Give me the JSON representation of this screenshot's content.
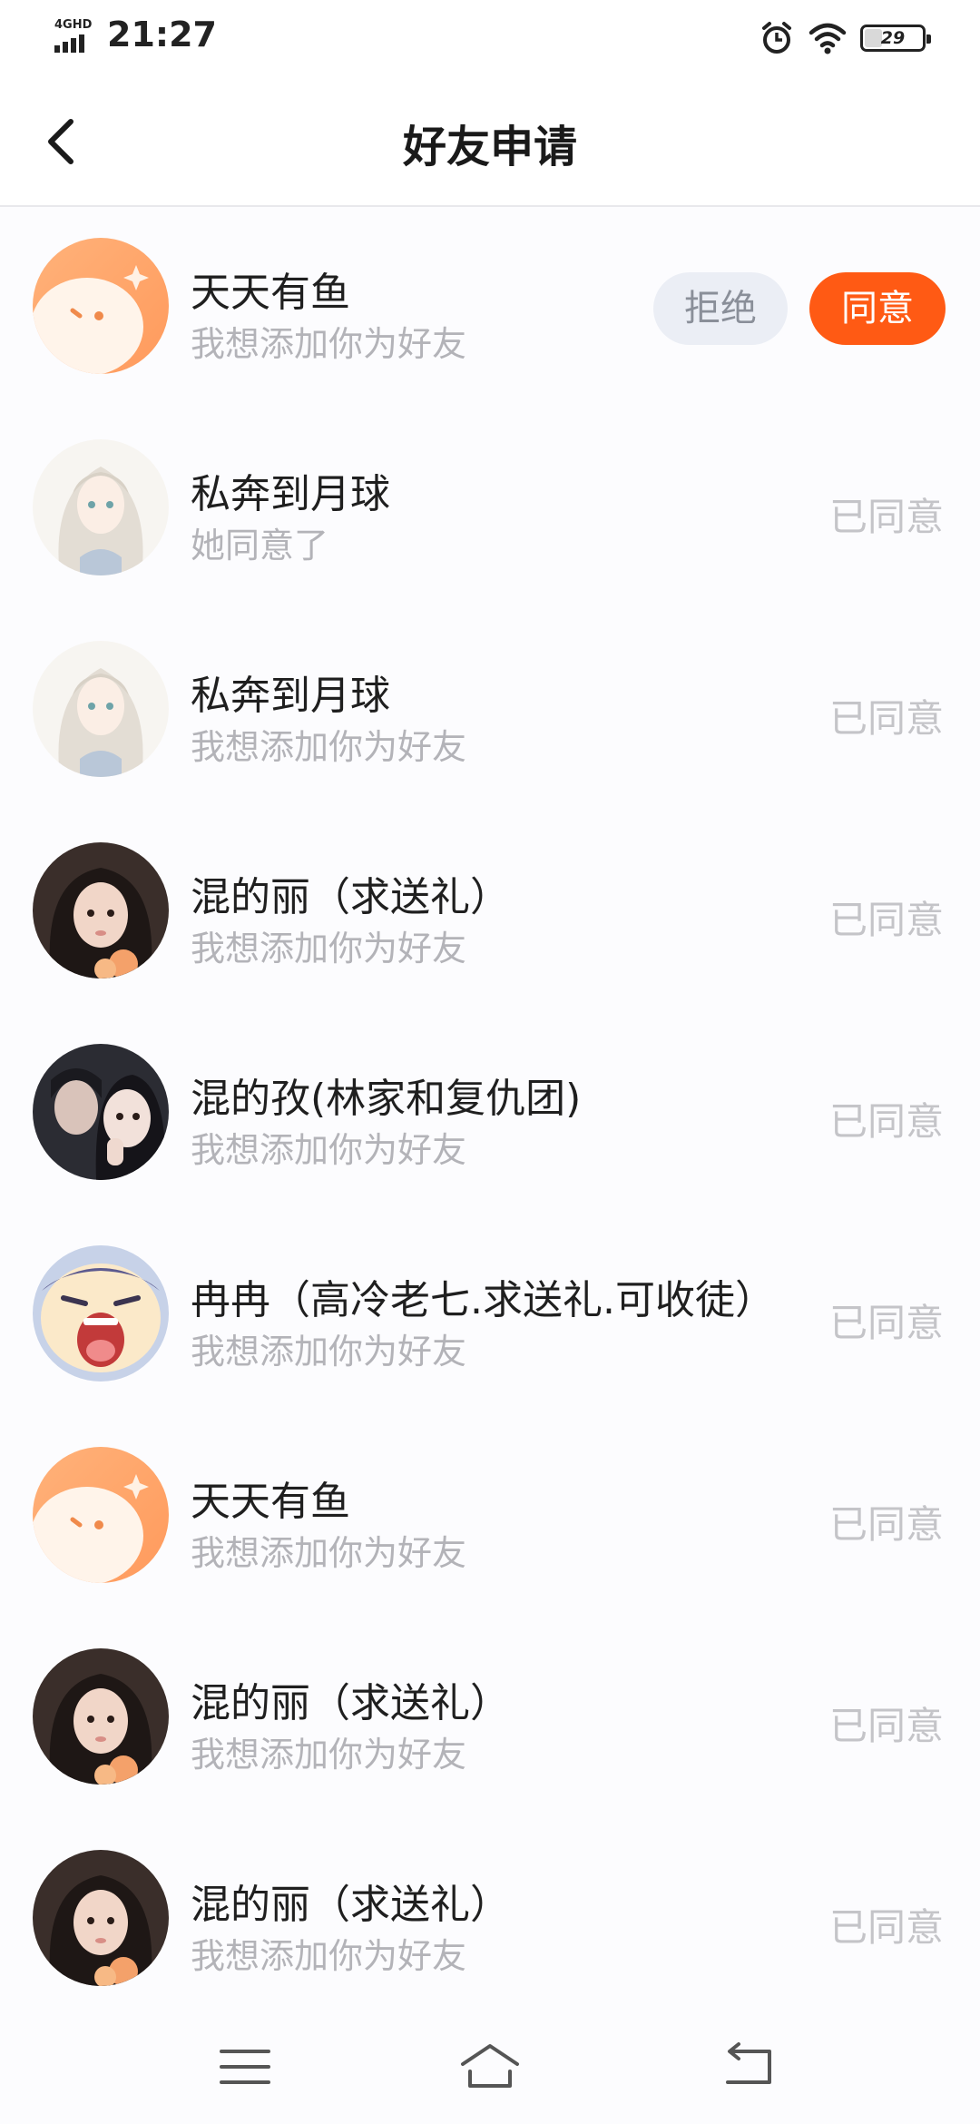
{
  "status_bar": {
    "network": "4GHD",
    "time": "21:27",
    "battery": "29",
    "battery_level": 0.29,
    "icons": [
      "signal-icon",
      "alarm-icon",
      "wifi-icon",
      "battery-icon"
    ]
  },
  "header": {
    "title": "好友申请",
    "back_icon": "chevron-left-icon"
  },
  "colors": {
    "accent": "#ff5a14",
    "reject_bg": "#ebeef5",
    "muted_text": "#b3b3b8"
  },
  "requests": [
    {
      "name": "天天有鱼",
      "message": "我想添加你为好友",
      "reject_label": "拒绝",
      "accept_label": "同意",
      "avatar": "fish-avatar"
    },
    {
      "name": "私奔到月球",
      "message": "她同意了",
      "status": "已同意",
      "avatar": "anime-girl-avatar"
    },
    {
      "name": "私奔到月球",
      "message": "我想添加你为好友",
      "status": "已同意",
      "avatar": "anime-girl-avatar"
    },
    {
      "name": "混的丽（求送礼）",
      "message": "我想添加你为好友",
      "status": "已同意",
      "avatar": "photo-avatar"
    },
    {
      "name": "混的孜(林家和复仇团)",
      "message": "我想添加你为好友",
      "status": "已同意",
      "avatar": "photo-avatar"
    },
    {
      "name": "冉冉（高冷老七.求送礼.可收徒）",
      "message": "我想添加你为好友",
      "status": "已同意",
      "avatar": "cartoon-avatar"
    },
    {
      "name": "天天有鱼",
      "message": "我想添加你为好友",
      "status": "已同意",
      "avatar": "fish-avatar"
    },
    {
      "name": "混的丽（求送礼）",
      "message": "我想添加你为好友",
      "status": "已同意",
      "avatar": "photo-avatar"
    },
    {
      "name": "混的丽（求送礼）",
      "message": "我想添加你为好友",
      "status": "已同意",
      "avatar": "photo-avatar"
    }
  ],
  "nav_bar": {
    "icons": [
      "menu-icon",
      "home-icon",
      "back-icon"
    ]
  }
}
